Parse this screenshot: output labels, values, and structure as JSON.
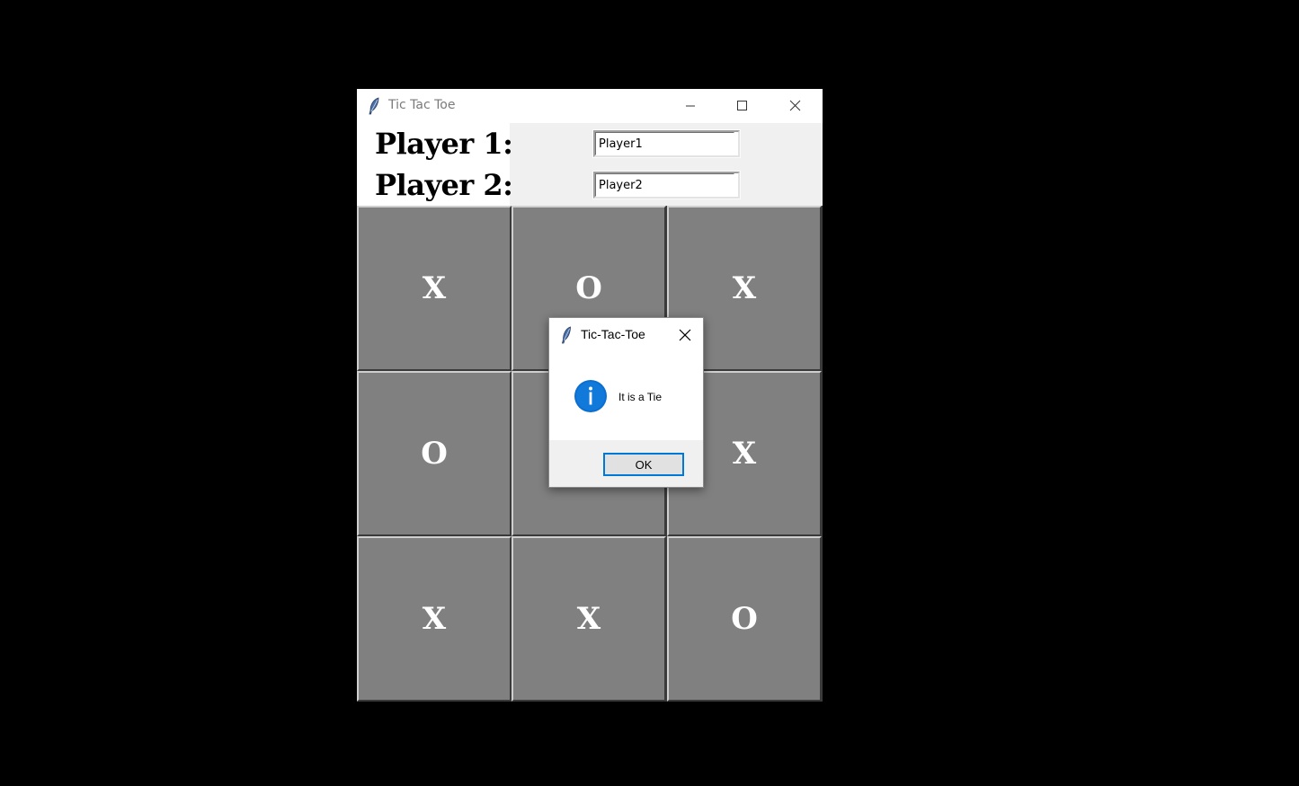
{
  "window": {
    "title": "Tic Tac Toe",
    "icon": "feather-icon",
    "controls": [
      "minimize-icon",
      "maximize-icon",
      "close-icon"
    ]
  },
  "players": {
    "player1_label": "Player 1:",
    "player2_label": "Player 2:",
    "player1_value": "Player1",
    "player2_value": "Player2"
  },
  "board": {
    "cells": [
      "X",
      "O",
      "X",
      "O",
      "",
      "X",
      "X",
      "X",
      "O"
    ]
  },
  "dialog": {
    "title": "Tic-Tac-Toe",
    "icon": "info-icon",
    "message": "It is a Tie",
    "ok_label": "OK"
  },
  "colors": {
    "desktop": "#000000",
    "cell": "#808080",
    "cell_text": "#ffffff",
    "accent": "#0078d7"
  }
}
